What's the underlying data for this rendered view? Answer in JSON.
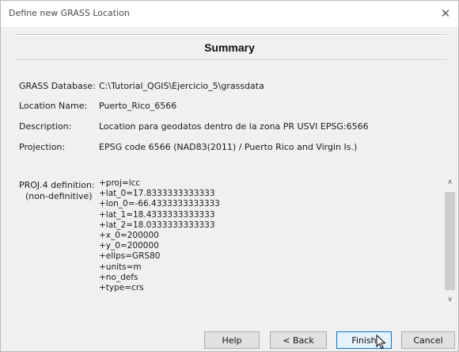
{
  "window": {
    "title": "Define new GRASS Location",
    "close_glyph": "✕"
  },
  "heading": "Summary",
  "summary_rows": [
    {
      "label": "GRASS Database:",
      "value": "C:\\Tutorial_QGIS\\Ejercicio_5\\grassdata"
    },
    {
      "label": "Location Name:",
      "value": "Puerto_Rico_6566"
    },
    {
      "label": "Description:",
      "value": "Location para geodatos dentro de la zona PR USVI EPSG:6566"
    },
    {
      "label": "Projection:",
      "value": "EPSG code 6566 (NAD83(2011) / Puerto Rico and Virgin Is.)"
    }
  ],
  "proj4": {
    "label_line1": "PROJ.4 definition:",
    "label_line2": "(non-definitive)",
    "lines": [
      "+proj=lcc",
      "+lat_0=17.8333333333333",
      "+lon_0=-66.4333333333333",
      "+lat_1=18.4333333333333",
      "+lat_2=18.0333333333333",
      "+x_0=200000",
      "+y_0=200000",
      "+ellps=GRS80",
      "+units=m",
      "+no_defs",
      "+type=crs"
    ]
  },
  "scrollbar": {
    "up_glyph": "∧",
    "down_glyph": "∨"
  },
  "buttons": {
    "help": "Help",
    "back": "< Back",
    "finish": "Finish",
    "cancel": "Cancel"
  }
}
